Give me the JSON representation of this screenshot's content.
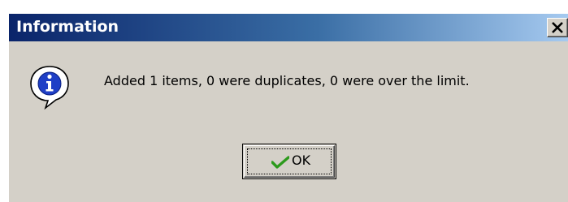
{
  "dialog": {
    "title": "Information",
    "message": "Added 1 items, 0 were duplicates, 0 were over the limit.",
    "ok_label": "OK",
    "close_icon": "close-icon",
    "message_icon": "info-icon",
    "button_icon": "checkmark-icon"
  },
  "colors": {
    "title_gradient_start": "#0a246a",
    "title_gradient_end": "#a6caf0",
    "dialog_background": "#d4d0c8",
    "info_icon_blue": "#1f3fc6",
    "check_green": "#2c9a1c"
  }
}
